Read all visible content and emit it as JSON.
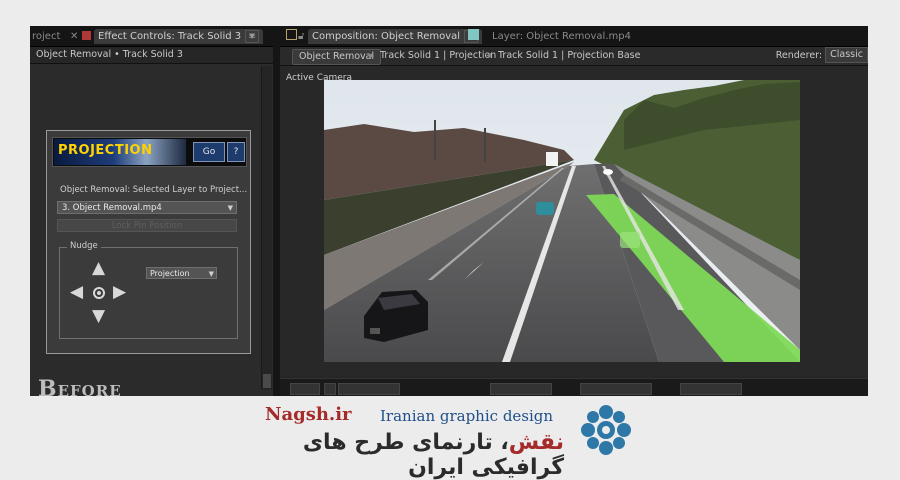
{
  "left_panel": {
    "tab_project": "roject",
    "tab_effect_controls": "Effect Controls: Track Solid 3",
    "subheader": "Object Removal • Track Solid 3",
    "plugin": {
      "banner": "PROJECTION",
      "go_label": "Go",
      "help_label": "?",
      "selected_layer_label": "Object Removal: Selected Layer to Project...",
      "layer_value": "3. Object Removal.mp4",
      "lock_label": "Lock Pin Position",
      "nudge_label": "Nudge",
      "nudge_mode": "Projection"
    },
    "watermark": "Before"
  },
  "right_panel": {
    "tab_composition": "Composition: Object Removal",
    "tab_layer": "Layer: Object Removal.mp4",
    "breadcrumbs": [
      "Object Removal",
      "Track Solid 1 | Projection",
      "Track Solid 1 | Projection Base"
    ],
    "renderer_label": "Renderer:",
    "renderer_value": "Classic",
    "view_label": "Active Camera"
  },
  "footer": {
    "site": "Nagsh.ir",
    "tagline": "Iranian graphic design",
    "persian_red": "نقش",
    "persian_rest": "، تارنمای طرح های گرافیکی ایران"
  },
  "colors": {
    "highlight_green": "#7ed957",
    "brand_red": "#a52b2b",
    "brand_blue": "#1f4f8a",
    "banner_yellow": "#ffd200"
  }
}
